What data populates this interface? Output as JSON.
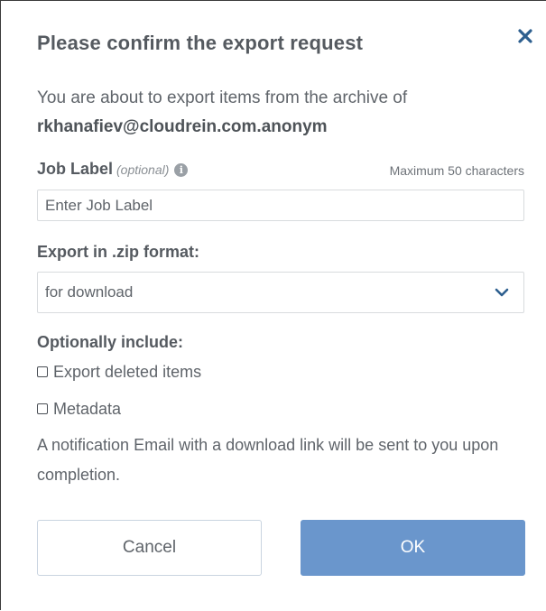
{
  "dialog": {
    "title": "Please confirm the export request",
    "close_icon": "close-icon",
    "intro_text": "You are about to export items from the archive of",
    "account_email": "rkhanafiev@cloudrein.com.anonym"
  },
  "job_label": {
    "label": "Job Label",
    "optional_hint": "(optional)",
    "info_icon": "info-icon",
    "max_chars_note": "Maximum 50 characters",
    "placeholder": "Enter Job Label",
    "value": ""
  },
  "export_format": {
    "label": "Export in .zip format:",
    "selected": "for download",
    "dropdown_icon": "chevron-down-icon"
  },
  "optional_include": {
    "label": "Optionally include:",
    "options": [
      {
        "label": "Export deleted items",
        "checked": false
      },
      {
        "label": "Metadata",
        "checked": false
      }
    ]
  },
  "notice": "A notification Email with a download link will be sent to you upon completion.",
  "buttons": {
    "cancel_label": "Cancel",
    "ok_label": "OK"
  },
  "colors": {
    "title_text": "#555a60",
    "close_icon": "#2d5f8f",
    "ok_button_bg": "#6a96cc",
    "cancel_border": "#c9d4e0",
    "input_border": "#d8dbde"
  }
}
